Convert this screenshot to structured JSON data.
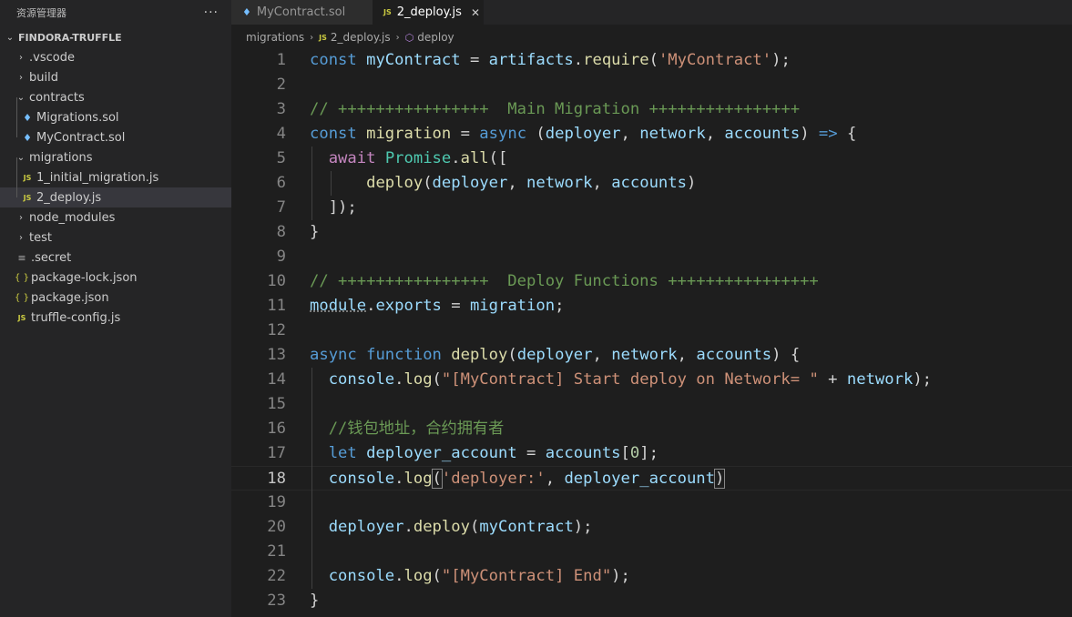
{
  "sidebar": {
    "title": "资源管理器",
    "more": "···",
    "project": "FINDORA-TRUFFLE",
    "items": [
      {
        "label": ".vscode",
        "type": "folder",
        "expanded": false,
        "level": 0
      },
      {
        "label": "build",
        "type": "folder",
        "expanded": false,
        "level": 0
      },
      {
        "label": "contracts",
        "type": "folder",
        "expanded": true,
        "level": 0
      },
      {
        "label": "Migrations.sol",
        "type": "sol",
        "level": 1
      },
      {
        "label": "MyContract.sol",
        "type": "sol",
        "level": 1
      },
      {
        "label": "migrations",
        "type": "folder",
        "expanded": true,
        "level": 0
      },
      {
        "label": "1_initial_migration.js",
        "type": "js",
        "level": 1
      },
      {
        "label": "2_deploy.js",
        "type": "js",
        "level": 1,
        "selected": true
      },
      {
        "label": "node_modules",
        "type": "folder",
        "expanded": false,
        "level": 0
      },
      {
        "label": "test",
        "type": "folder",
        "expanded": false,
        "level": 0
      },
      {
        "label": ".secret",
        "type": "lines",
        "level": 0
      },
      {
        "label": "package-lock.json",
        "type": "json",
        "level": 0
      },
      {
        "label": "package.json",
        "type": "json",
        "level": 0
      },
      {
        "label": "truffle-config.js",
        "type": "js",
        "level": 0
      }
    ]
  },
  "tabs": [
    {
      "label": "MyContract.sol",
      "icon": "solidity-icon",
      "active": false
    },
    {
      "label": "2_deploy.js",
      "icon": "js-icon",
      "active": true,
      "close": "✕"
    }
  ],
  "breadcrumb": {
    "folder": "migrations",
    "file": "2_deploy.js",
    "symbol": "deploy",
    "sep": "›"
  },
  "editor": {
    "active_line": 18,
    "lines": [
      {
        "n": "1",
        "t": [
          [
            "kw",
            "const"
          ],
          [
            "pun",
            " "
          ],
          [
            "var",
            "myContract"
          ],
          [
            "pun",
            " = "
          ],
          [
            "var",
            "artifacts"
          ],
          [
            "pun",
            "."
          ],
          [
            "fn",
            "require"
          ],
          [
            "pun",
            "("
          ],
          [
            "str",
            "'MyContract'"
          ],
          [
            "pun",
            ");"
          ]
        ]
      },
      {
        "n": "2",
        "t": []
      },
      {
        "n": "3",
        "t": [
          [
            "cmt",
            "// ++++++++++++++++  Main Migration ++++++++++++++++"
          ]
        ]
      },
      {
        "n": "4",
        "t": [
          [
            "kw",
            "const"
          ],
          [
            "pun",
            " "
          ],
          [
            "fn",
            "migration"
          ],
          [
            "pun",
            " = "
          ],
          [
            "kw",
            "async"
          ],
          [
            "pun",
            " ("
          ],
          [
            "var",
            "deployer"
          ],
          [
            "pun",
            ", "
          ],
          [
            "var",
            "network"
          ],
          [
            "pun",
            ", "
          ],
          [
            "var",
            "accounts"
          ],
          [
            "pun",
            ") "
          ],
          [
            "kw",
            "=>"
          ],
          [
            "pun",
            " {"
          ]
        ]
      },
      {
        "n": "5",
        "t": [
          [
            "pun",
            "  "
          ],
          [
            "kc",
            "await"
          ],
          [
            "pun",
            " "
          ],
          [
            "cls",
            "Promise"
          ],
          [
            "pun",
            "."
          ],
          [
            "fn",
            "all"
          ],
          [
            "pun",
            "(["
          ]
        ]
      },
      {
        "n": "6",
        "t": [
          [
            "pun",
            "      "
          ],
          [
            "fn",
            "deploy"
          ],
          [
            "pun",
            "("
          ],
          [
            "var",
            "deployer"
          ],
          [
            "pun",
            ", "
          ],
          [
            "var",
            "network"
          ],
          [
            "pun",
            ", "
          ],
          [
            "var",
            "accounts"
          ],
          [
            "pun",
            ")"
          ]
        ]
      },
      {
        "n": "7",
        "t": [
          [
            "pun",
            "  ]);"
          ]
        ]
      },
      {
        "n": "8",
        "t": [
          [
            "pun",
            "}"
          ]
        ]
      },
      {
        "n": "9",
        "t": []
      },
      {
        "n": "10",
        "t": [
          [
            "cmt",
            "// ++++++++++++++++  Deploy Functions ++++++++++++++++"
          ]
        ]
      },
      {
        "n": "11",
        "t": [
          [
            "var dotted",
            "module"
          ],
          [
            "pun",
            "."
          ],
          [
            "var",
            "exports"
          ],
          [
            "pun",
            " = "
          ],
          [
            "var",
            "migration"
          ],
          [
            "pun",
            ";"
          ]
        ]
      },
      {
        "n": "12",
        "t": []
      },
      {
        "n": "13",
        "t": [
          [
            "kw",
            "async"
          ],
          [
            "pun",
            " "
          ],
          [
            "kw",
            "function"
          ],
          [
            "pun",
            " "
          ],
          [
            "fn",
            "deploy"
          ],
          [
            "pun",
            "("
          ],
          [
            "var",
            "deployer"
          ],
          [
            "pun",
            ", "
          ],
          [
            "var",
            "network"
          ],
          [
            "pun",
            ", "
          ],
          [
            "var",
            "accounts"
          ],
          [
            "pun",
            ") {"
          ]
        ]
      },
      {
        "n": "14",
        "t": [
          [
            "pun",
            "  "
          ],
          [
            "var",
            "console"
          ],
          [
            "pun",
            "."
          ],
          [
            "fn",
            "log"
          ],
          [
            "pun",
            "("
          ],
          [
            "str",
            "\"[MyContract] Start deploy on Network= \""
          ],
          [
            "pun",
            " + "
          ],
          [
            "var",
            "network"
          ],
          [
            "pun",
            ");"
          ]
        ]
      },
      {
        "n": "15",
        "t": []
      },
      {
        "n": "16",
        "t": [
          [
            "pun",
            "  "
          ],
          [
            "cmt",
            "//钱包地址，合约拥有者"
          ]
        ]
      },
      {
        "n": "17",
        "t": [
          [
            "pun",
            "  "
          ],
          [
            "kw",
            "let"
          ],
          [
            "pun",
            " "
          ],
          [
            "var",
            "deployer_account"
          ],
          [
            "pun",
            " = "
          ],
          [
            "var",
            "accounts"
          ],
          [
            "pun",
            "["
          ],
          [
            "num",
            "0"
          ],
          [
            "pun",
            "];"
          ]
        ]
      },
      {
        "n": "18",
        "t": [
          [
            "pun",
            "  "
          ],
          [
            "var",
            "console"
          ],
          [
            "pun",
            "."
          ],
          [
            "fn",
            "log"
          ],
          [
            "pun brk",
            "("
          ],
          [
            "str",
            "'deployer:'"
          ],
          [
            "pun",
            ", "
          ],
          [
            "var",
            "deployer_account"
          ],
          [
            "pun brk",
            ")"
          ]
        ]
      },
      {
        "n": "19",
        "t": []
      },
      {
        "n": "20",
        "t": [
          [
            "pun",
            "  "
          ],
          [
            "var",
            "deployer"
          ],
          [
            "pun",
            "."
          ],
          [
            "fn",
            "deploy"
          ],
          [
            "pun",
            "("
          ],
          [
            "var",
            "myContract"
          ],
          [
            "pun",
            ");"
          ]
        ]
      },
      {
        "n": "21",
        "t": []
      },
      {
        "n": "22",
        "t": [
          [
            "pun",
            "  "
          ],
          [
            "var",
            "console"
          ],
          [
            "pun",
            "."
          ],
          [
            "fn",
            "log"
          ],
          [
            "pun",
            "("
          ],
          [
            "str",
            "\"[MyContract] End\""
          ],
          [
            "pun",
            ");"
          ]
        ]
      },
      {
        "n": "23",
        "t": [
          [
            "pun",
            "}"
          ]
        ]
      }
    ]
  },
  "colors": {
    "editor_bg": "#1e1e1e",
    "sidebar_bg": "#252526",
    "keyword": "#569cd6",
    "string": "#ce9178",
    "comment": "#6a9955",
    "function": "#dcdcaa",
    "variable": "#9cdcfe"
  }
}
